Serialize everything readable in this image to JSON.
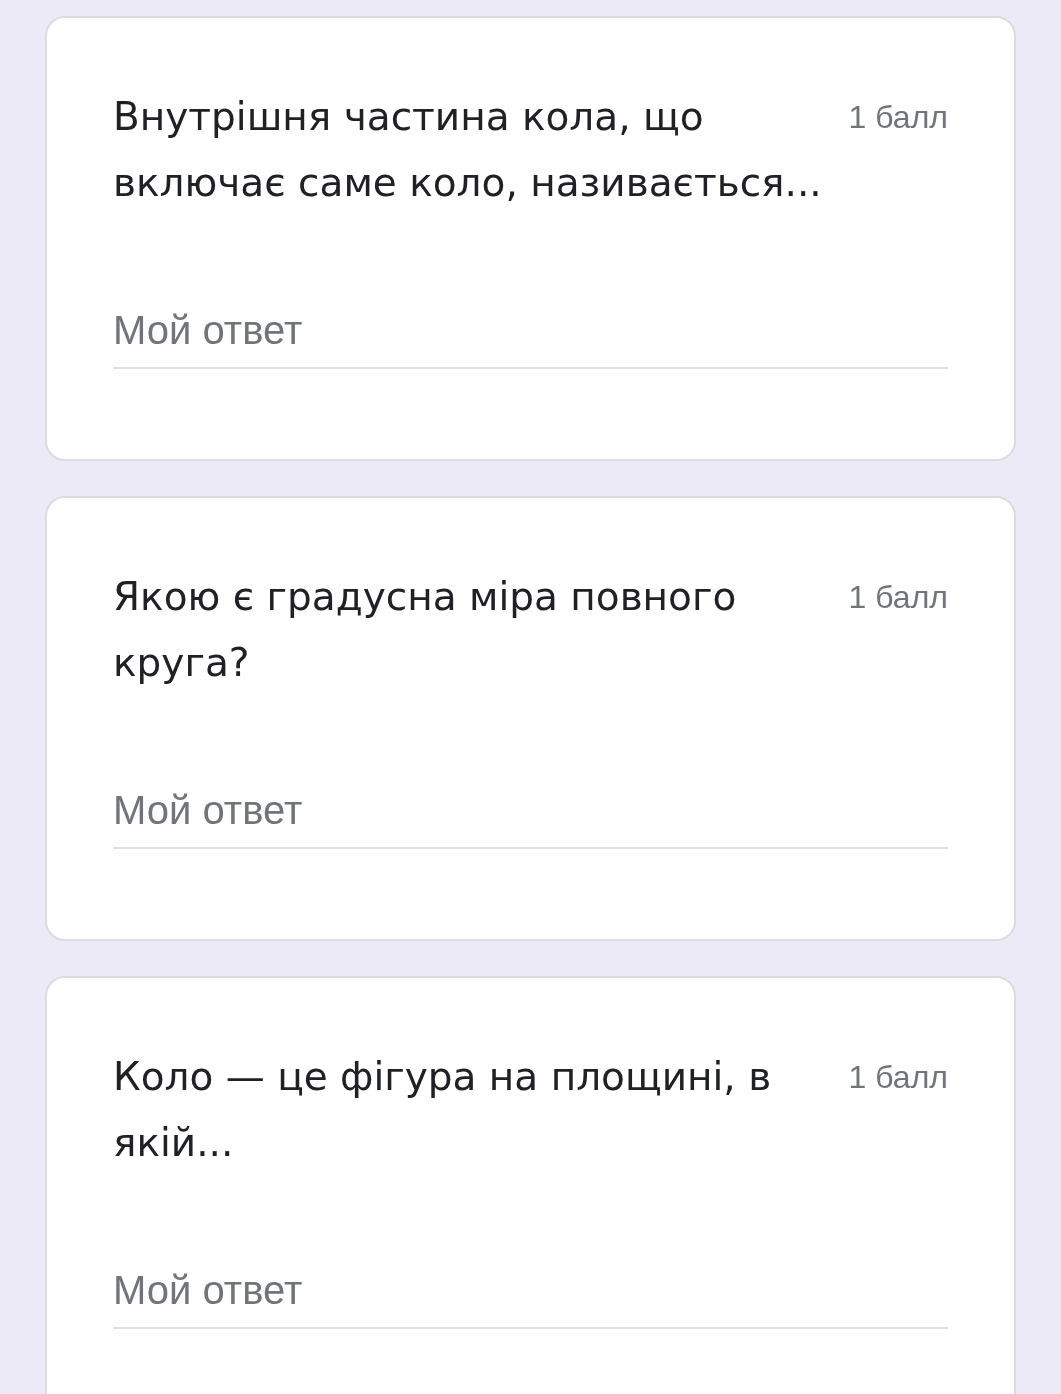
{
  "questions": [
    {
      "text": "Внутрішня частина кола, що включає саме коло, називається...",
      "points": "1 балл",
      "answer": {
        "placeholder": "Мой ответ"
      }
    },
    {
      "text": "Якою є градусна міра повного круга?",
      "points": "1 балл",
      "answer": {
        "placeholder": "Мой ответ"
      }
    },
    {
      "text": "Коло — це фігура на площині, в якій...",
      "points": "1 балл",
      "answer": {
        "placeholder": "Мой ответ"
      }
    }
  ]
}
